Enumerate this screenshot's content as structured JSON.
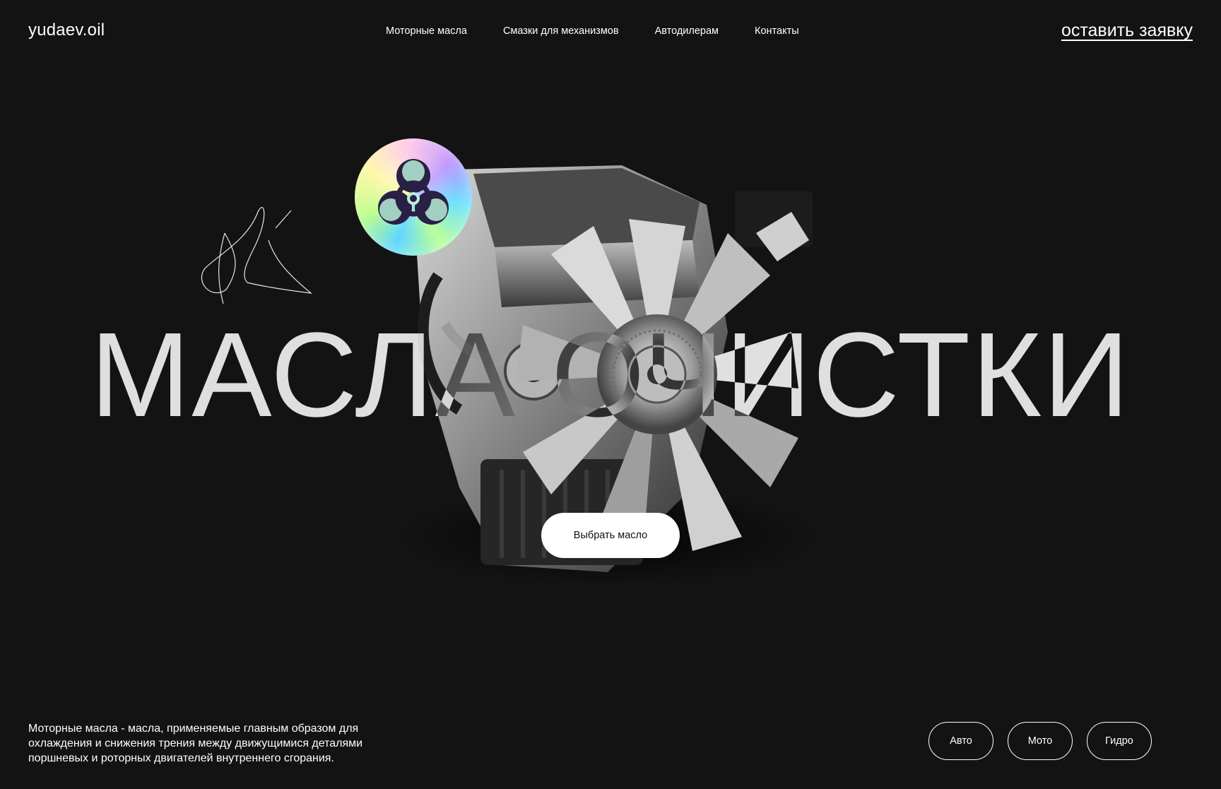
{
  "header": {
    "logo": "yudaev.oil",
    "nav": [
      {
        "label": "Моторные масла"
      },
      {
        "label": "Смазки для механизмов"
      },
      {
        "label": "Автодилерам"
      },
      {
        "label": "Контакты"
      }
    ],
    "cta_label": "оставить заявку"
  },
  "hero": {
    "headline": "МАСЛА ОЧИСТКИ",
    "button_label": "Выбрать масло",
    "badge_icon": "biohazard-icon",
    "image": "engine-image"
  },
  "footer": {
    "description": "Моторные масла - масла, применяемые главным образом для охлаждения и снижения трения между движущимися деталями поршневых и роторных двигателей внутреннего сгорания.",
    "categories": [
      {
        "label": "Авто"
      },
      {
        "label": "Мото"
      },
      {
        "label": "Гидро"
      }
    ]
  },
  "colors": {
    "background": "#131313",
    "text": "#ffffff",
    "button_bg": "#ffffff",
    "button_text": "#111111"
  }
}
